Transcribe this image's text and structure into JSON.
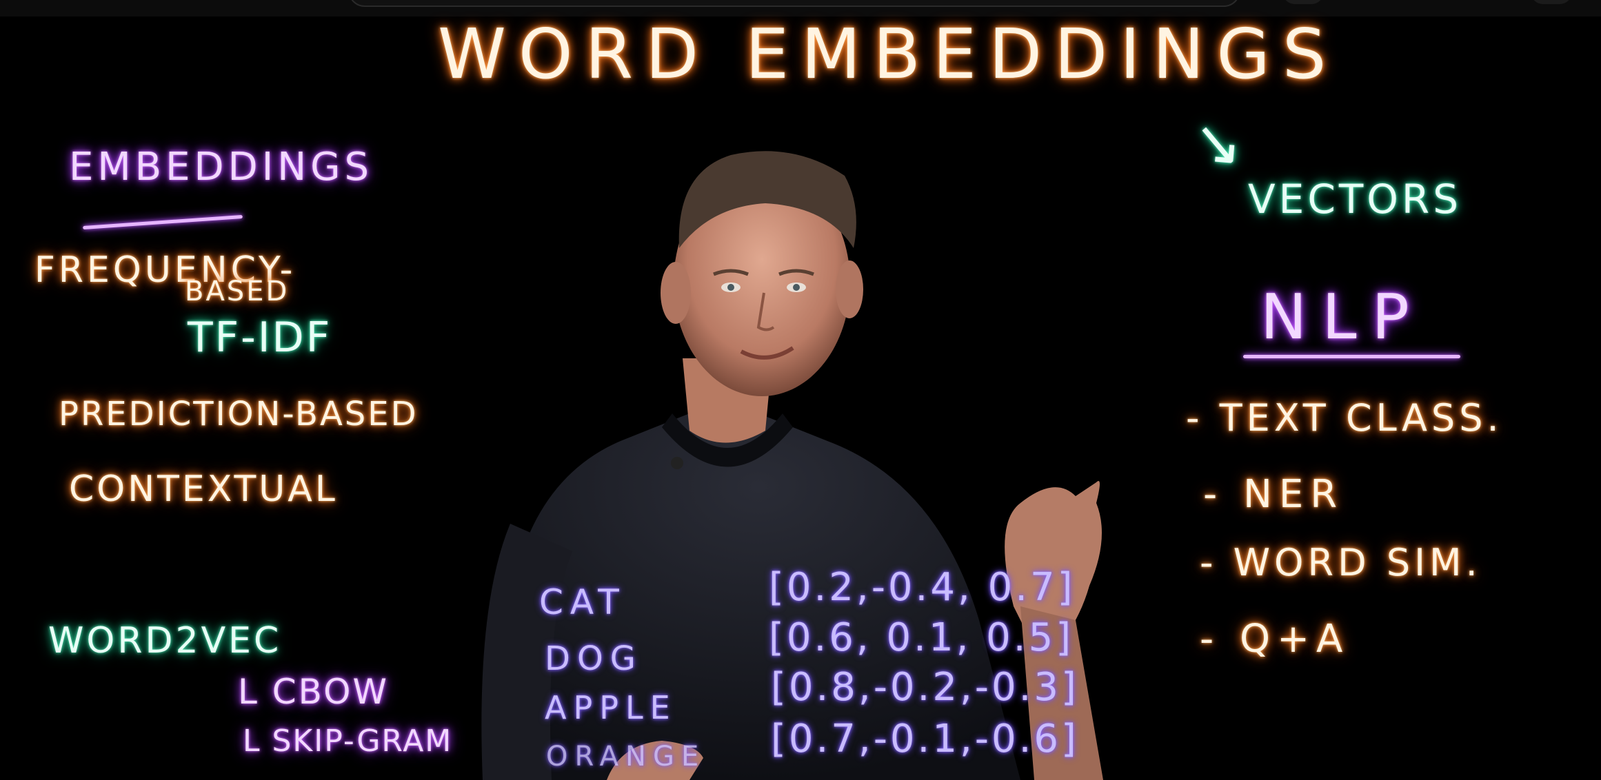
{
  "board": {
    "title": "WORD EMBEDDINGS",
    "left": {
      "heading": "EMBEDDINGS",
      "frequency": "FREQUENCY-",
      "based": "BASED",
      "tfidf": "TF-IDF",
      "prediction": "PREDICTION-BASED",
      "contextual": "CONTEXTUAL",
      "word2vec": "WORD2VEC",
      "cbow": "L CBOW",
      "skipgram": "L SKIP-GRAM"
    },
    "right": {
      "arrow": "↘",
      "vectors": "VECTORS",
      "nlp": "NLP",
      "items": [
        "- TEXT CLASS.",
        "- NER",
        "- WORD SIM.",
        "- Q+A"
      ]
    },
    "vectors_table": [
      {
        "word": "CAT",
        "vector": "[0.2,-0.4, 0.7]"
      },
      {
        "word": "DOG",
        "vector": "[0.6, 0.1, 0.5]"
      },
      {
        "word": "APPLE",
        "vector": "[0.8,-0.2,-0.3]"
      },
      {
        "word": "ORANGE",
        "vector": "[0.7,-0.1,-0.6]"
      }
    ]
  },
  "colors": {
    "background": "#000000",
    "chalk_white": "#fff4e2",
    "chalk_purple": "#f2d8ff",
    "chalk_teal": "#e8fff6",
    "chalk_violet": "#c9bcff",
    "shirt": "#15161c",
    "skin": "#c98f78"
  }
}
